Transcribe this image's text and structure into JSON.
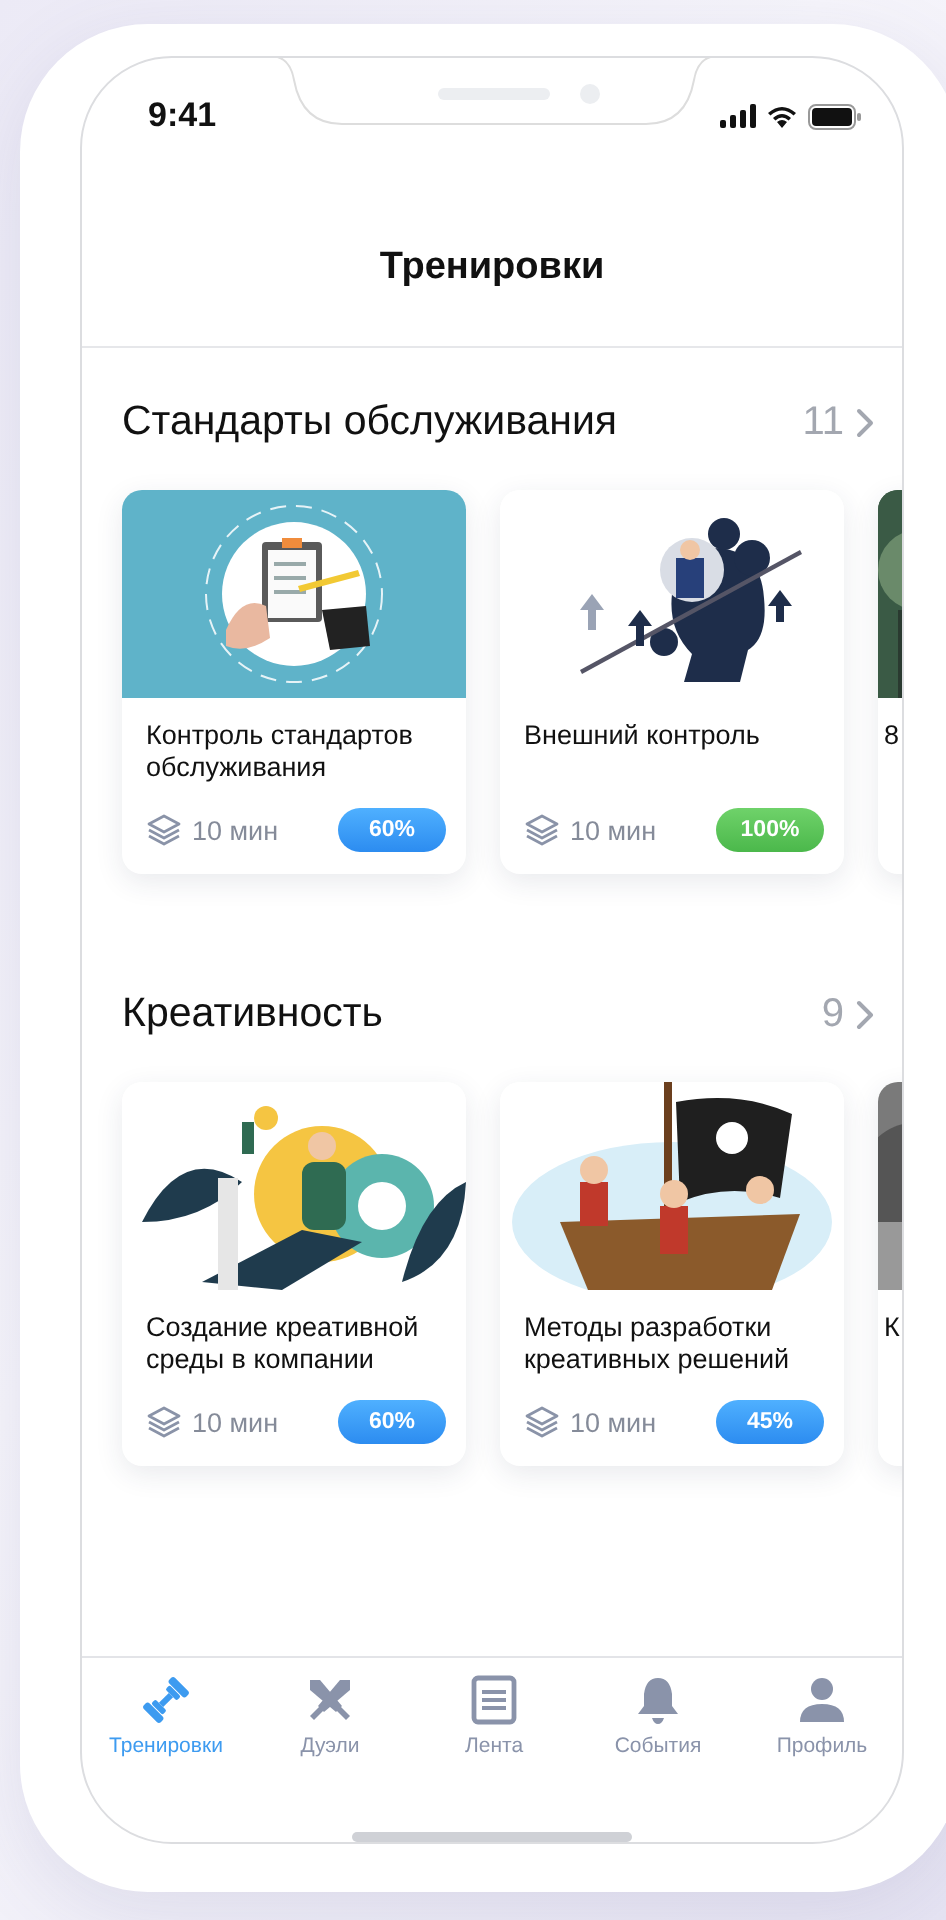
{
  "status_bar": {
    "time": "9:41"
  },
  "header": {
    "title": "Тренировки"
  },
  "sections": [
    {
      "title": "Стандарты обслуживания",
      "count": "11",
      "cards": [
        {
          "title": "Контроль стандартов обслуживания",
          "duration": "10 мин",
          "progress": "60%",
          "complete": false
        },
        {
          "title": "Внешний контроль",
          "duration": "10 мин",
          "progress": "100%",
          "complete": true
        },
        {
          "title": "8"
        }
      ]
    },
    {
      "title": "Креативность",
      "count": "9",
      "cards": [
        {
          "title": "Создание креативной среды в компании",
          "duration": "10 мин",
          "progress": "60%",
          "complete": false
        },
        {
          "title": "Методы разработки креативных решений",
          "duration": "10 мин",
          "progress": "45%",
          "complete": false
        },
        {
          "title": "К"
        }
      ]
    }
  ],
  "tab_bar": [
    {
      "label": "Тренировки",
      "selected": true
    },
    {
      "label": "Дуэли",
      "selected": false
    },
    {
      "label": "Лента",
      "selected": false
    },
    {
      "label": "События",
      "selected": false
    },
    {
      "label": "Профиль",
      "selected": false
    }
  ]
}
